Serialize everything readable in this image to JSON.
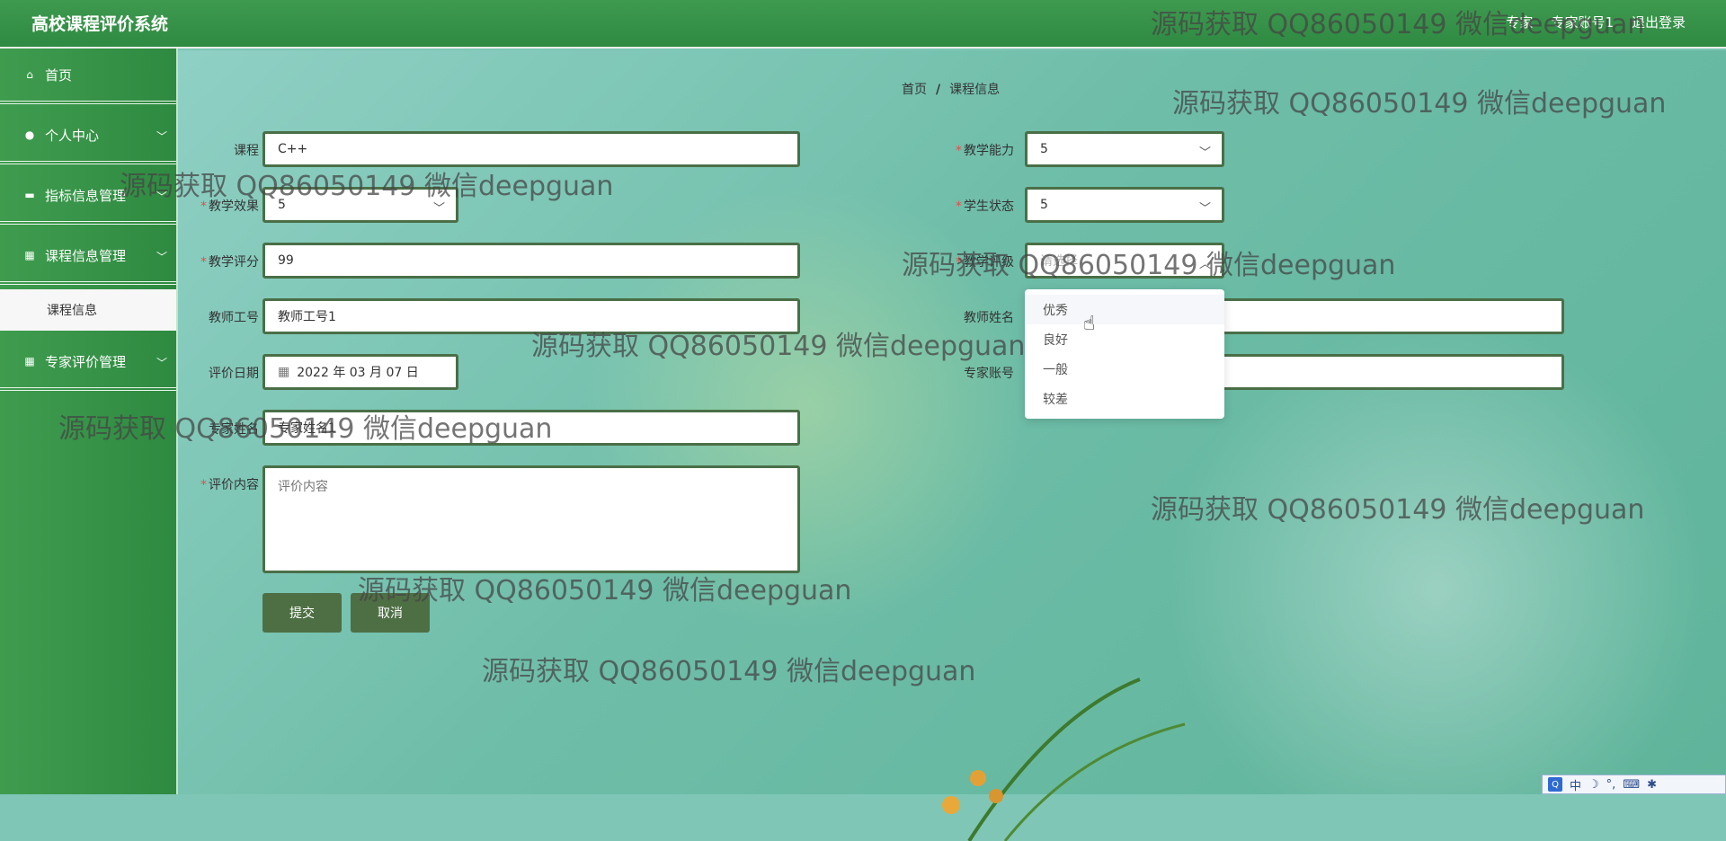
{
  "header": {
    "title": "高校课程评价系统",
    "role": "专家",
    "account": "专家账号1",
    "logout": "退出登录"
  },
  "sidebar": {
    "items": [
      {
        "label": "首页",
        "icon": "home-icon"
      },
      {
        "label": "个人中心",
        "icon": "user-icon"
      },
      {
        "label": "指标信息管理",
        "icon": "chat-icon"
      },
      {
        "label": "课程信息管理",
        "icon": "grid-icon"
      },
      {
        "label": "专家评价管理",
        "icon": "grid-icon"
      }
    ],
    "submenu": {
      "label": "课程信息"
    }
  },
  "breadcrumb": {
    "home": "首页",
    "sep": "/",
    "current": "课程信息"
  },
  "form": {
    "course": {
      "label": "课程",
      "value": "C++"
    },
    "teaching_ability": {
      "label": "教学能力",
      "value": "5"
    },
    "teaching_effect": {
      "label": "教学效果",
      "value": "5"
    },
    "student_status": {
      "label": "学生状态",
      "value": "5"
    },
    "teaching_score": {
      "label": "教学评分",
      "value": "99"
    },
    "teaching_level": {
      "label": "教学评级",
      "placeholder": "请选择"
    },
    "teacher_id": {
      "label": "教师工号",
      "value": "教师工号1"
    },
    "teacher_name": {
      "label": "教师姓名",
      "value": ""
    },
    "eval_date": {
      "label": "评价日期",
      "value": "2022 年 03 月 07 日"
    },
    "expert_account": {
      "label": "专家账号",
      "value": "专家"
    },
    "expert_name": {
      "label": "专家姓名",
      "value": "专家姓名1"
    },
    "content": {
      "label": "评价内容",
      "placeholder": "评价内容"
    },
    "submit": "提交",
    "cancel": "取消"
  },
  "dropdown": {
    "options": [
      "优秀",
      "良好",
      "一般",
      "较差"
    ]
  },
  "watermark": "源码获取 QQ86050149 微信deepguan",
  "ime": {
    "label": "中"
  },
  "colors": {
    "primary_green": "#2f8a42",
    "border_green": "#4a6f47",
    "button": "#4e6f44",
    "required": "#e0504a"
  }
}
